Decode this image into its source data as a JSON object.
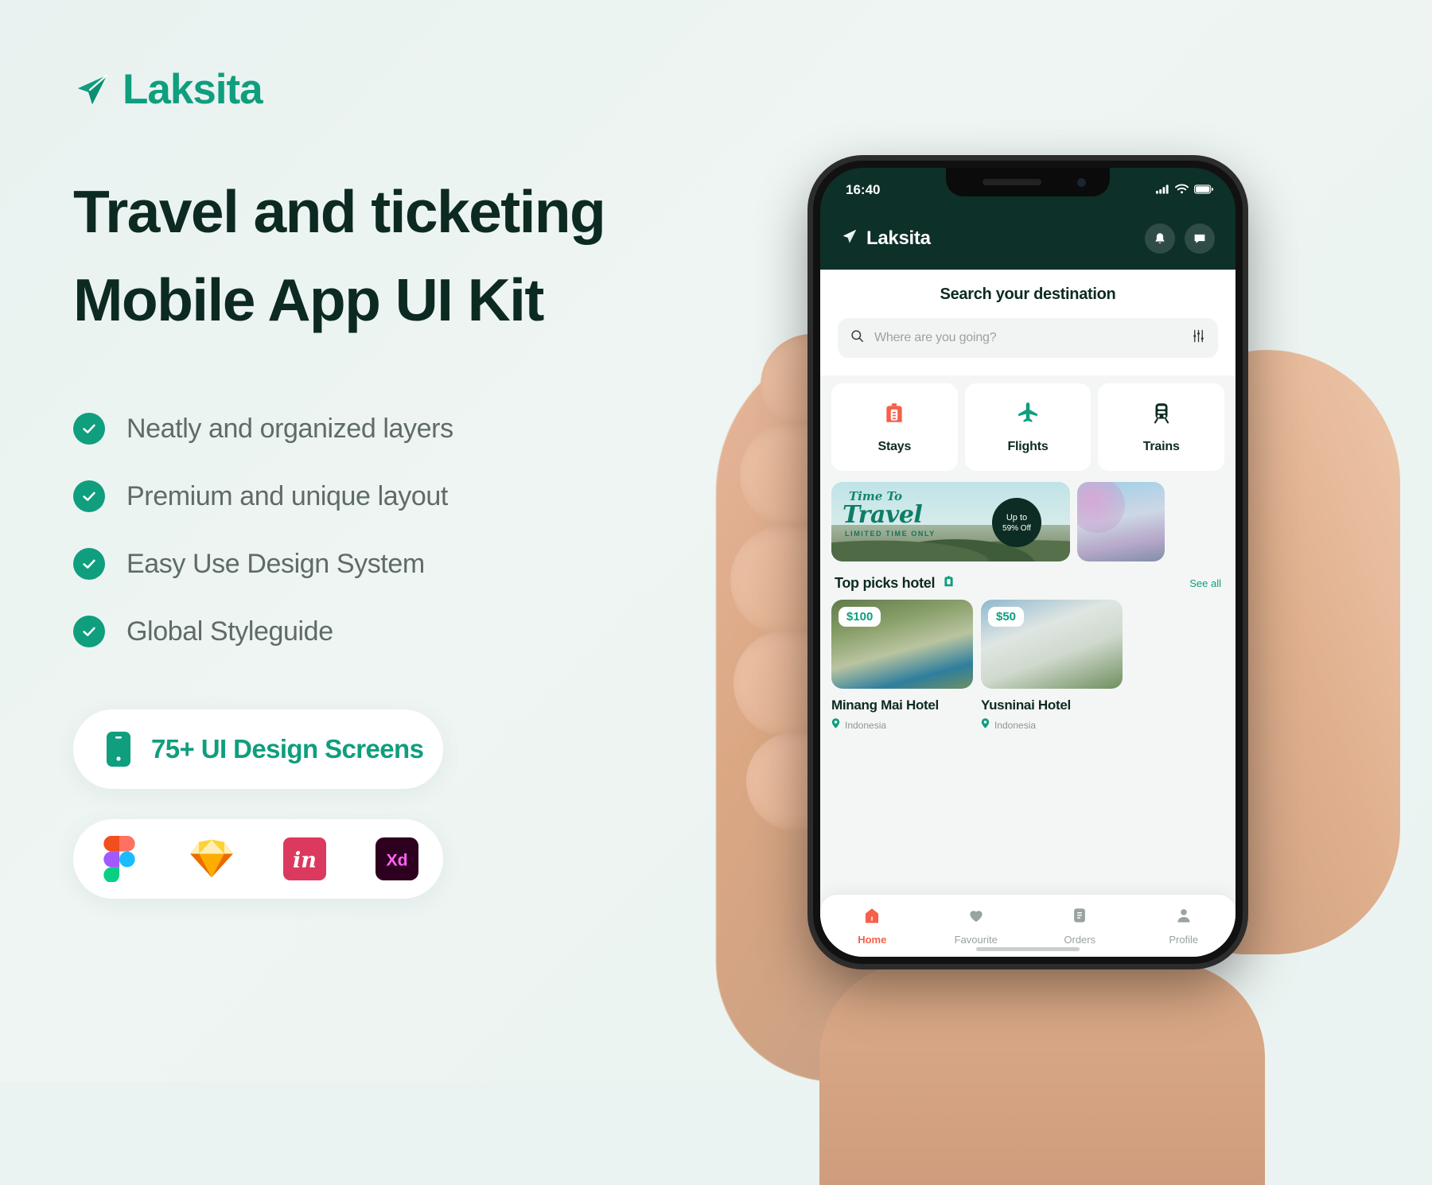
{
  "brand": {
    "name": "Laksita",
    "logo_icon": "paper-plane-icon",
    "color": "#0f9e7e"
  },
  "headline": {
    "line1": "Travel and ticketing",
    "line2": "Mobile App UI Kit"
  },
  "features": [
    {
      "label": "Neatly and organized layers",
      "icon": "check-circle-icon"
    },
    {
      "label": "Premium and unique layout",
      "icon": "check-circle-icon"
    },
    {
      "label": "Easy Use Design System",
      "icon": "check-circle-icon"
    },
    {
      "label": "Global Styleguide",
      "icon": "check-circle-icon"
    }
  ],
  "screens_pill": {
    "icon": "mobile-phone-icon",
    "label": "75+ UI Design Screens"
  },
  "tools": [
    {
      "name": "figma-logo-icon",
      "label": "Figma"
    },
    {
      "name": "sketch-logo-icon",
      "label": "Sketch"
    },
    {
      "name": "invision-logo-icon",
      "label": "InVision"
    },
    {
      "name": "adobe-xd-logo-icon",
      "label": "Adobe XD"
    }
  ],
  "phone": {
    "statusbar": {
      "time": "16:40",
      "icons": [
        "signal-icon",
        "wifi-icon",
        "battery-icon"
      ]
    },
    "app_header": {
      "brand": "Laksita",
      "logo_icon": "paper-plane-icon",
      "actions": [
        "notification-bell-icon",
        "chat-message-icon"
      ]
    },
    "search": {
      "title": "Search your destination",
      "placeholder": "Where are you going?",
      "search_icon": "search-icon",
      "filter_icon": "filter-sliders-icon"
    },
    "categories": [
      {
        "label": "Stays",
        "icon": "hotel-building-icon",
        "color": "#f4604a"
      },
      {
        "label": "Flights",
        "icon": "airplane-icon",
        "color": "#0f9e7e"
      },
      {
        "label": "Trains",
        "icon": "train-icon",
        "color": "#0c2a22"
      }
    ],
    "promo": {
      "title_line1": "Time To",
      "title_line2": "Travel",
      "subtitle": "LIMITED TIME ONLY",
      "badge_line1": "Up to",
      "badge_line2": "59% Off"
    },
    "section": {
      "title": "Top picks hotel",
      "title_icon": "hotel-building-icon",
      "see_all": "See all"
    },
    "hotels": [
      {
        "name": "Minang Mai Hotel",
        "price": "$100",
        "location": "Indonesia",
        "pin_icon": "location-pin-icon"
      },
      {
        "name": "Yusninai Hotel",
        "price": "$50",
        "location": "Indonesia",
        "pin_icon": "location-pin-icon"
      }
    ],
    "tabs": [
      {
        "label": "Home",
        "icon": "home-icon",
        "active": true
      },
      {
        "label": "Favourite",
        "icon": "heart-icon",
        "active": false
      },
      {
        "label": "Orders",
        "icon": "orders-icon",
        "active": false
      },
      {
        "label": "Profile",
        "icon": "person-icon",
        "active": false
      }
    ]
  }
}
